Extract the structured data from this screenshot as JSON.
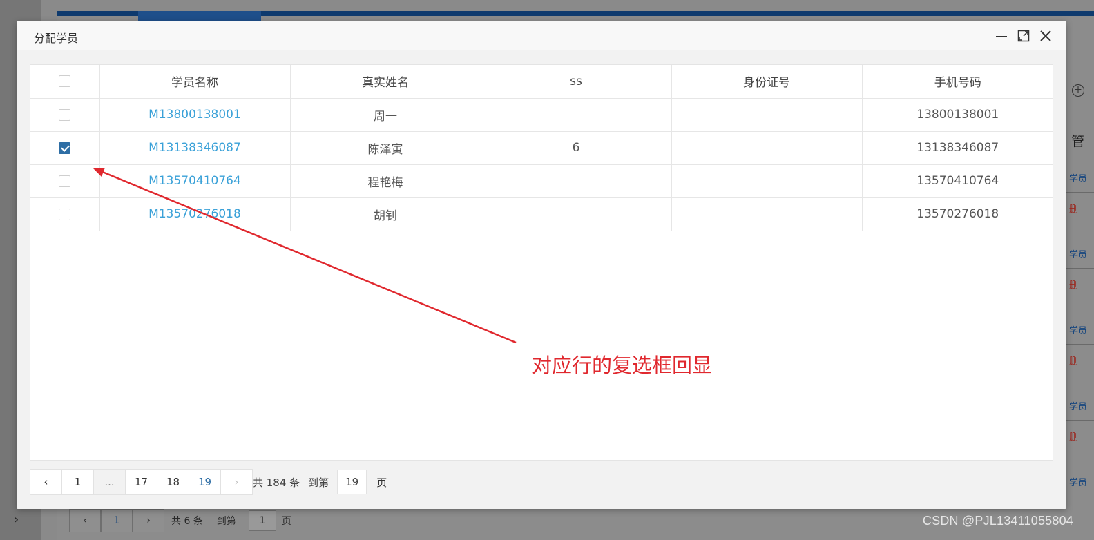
{
  "modal": {
    "title": "分配学员",
    "controls": {
      "minimize": "minimize-icon",
      "maximize": "maximize-icon",
      "close": "close-icon"
    }
  },
  "table": {
    "columns": [
      "学员名称",
      "真实姓名",
      "ss",
      "身份证号",
      "手机号码"
    ],
    "rows": [
      {
        "checked": false,
        "name": "M13800138001",
        "real_name": "周一",
        "ss": "",
        "id_card": "",
        "phone": "13800138001"
      },
      {
        "checked": true,
        "name": "M13138346087",
        "real_name": "陈泽寅",
        "ss": "6",
        "id_card": "",
        "phone": "13138346087"
      },
      {
        "checked": false,
        "name": "M13570410764",
        "real_name": "程艳梅",
        "ss": "",
        "id_card": "",
        "phone": "13570410764"
      },
      {
        "checked": false,
        "name": "M13570276018",
        "real_name": "胡钊",
        "ss": "",
        "id_card": "",
        "phone": "13570276018"
      }
    ]
  },
  "pager": {
    "prev": "‹",
    "pages": [
      "1",
      "...",
      "17",
      "18",
      "19"
    ],
    "current": "19",
    "next": "›",
    "total_text": "共 184 条",
    "goto_label": "到第",
    "goto_value": "19",
    "page_unit": "页"
  },
  "annotation": {
    "text": "对应行的复选框回显",
    "color": "#e0282e"
  },
  "background": {
    "pager": {
      "prev": "‹",
      "current": "1",
      "next": "›",
      "total_text": "共 6 条",
      "goto_label": "到第",
      "goto_value": "1",
      "page_unit": "页"
    },
    "right_fragments": [
      "管",
      "学员",
      "删",
      "学员",
      "删",
      "学员",
      "删",
      "学员",
      "删",
      "学员"
    ]
  },
  "watermark": "CSDN @PJL13411055804",
  "colors": {
    "link": "#3aa1d8",
    "checkbox_checked": "#2e6ea5",
    "annotation": "#e0282e"
  }
}
